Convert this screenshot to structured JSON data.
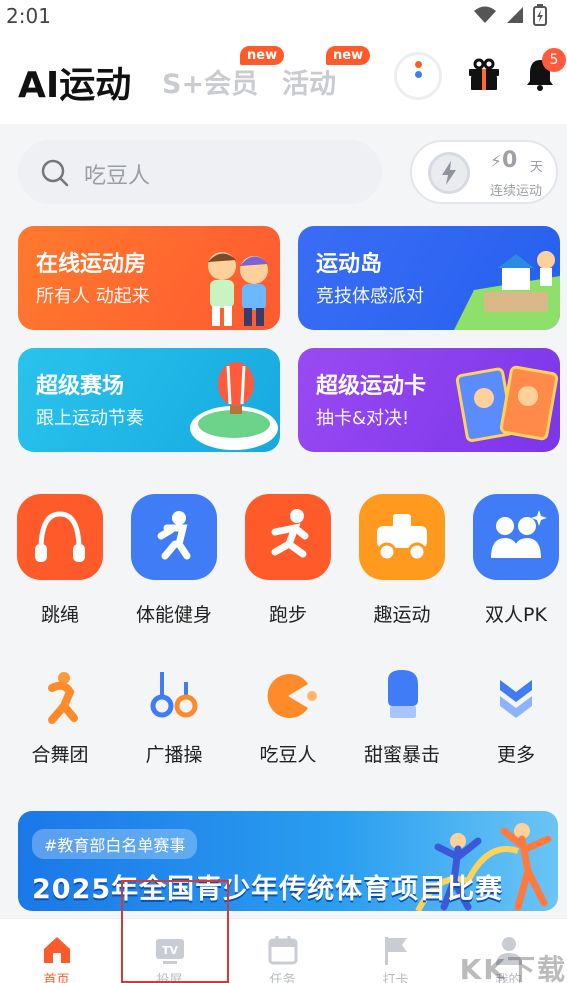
{
  "status": {
    "time": "2:01"
  },
  "header": {
    "title": "AI运动",
    "tabs": [
      {
        "label": "S+会员",
        "badge": "new"
      },
      {
        "label": "活动",
        "badge": "new"
      }
    ],
    "notification_count": "5"
  },
  "search": {
    "placeholder": "吃豆人"
  },
  "streak": {
    "count": "0",
    "unit": "天",
    "label": "连续运动"
  },
  "cards": [
    {
      "title": "在线运动房",
      "subtitle": "所有人 动起来",
      "color": "#ff6a2e"
    },
    {
      "title": "运动岛",
      "subtitle": "竞技体感派对",
      "color": "#2e6cf5"
    },
    {
      "title": "超级赛场",
      "subtitle": "跟上运动节奏",
      "color": "#22b8e6"
    },
    {
      "title": "超级运动卡",
      "subtitle": "抽卡&对决!",
      "color": "#8a3cf0"
    }
  ],
  "grid_row1": [
    {
      "label": "跳绳",
      "icon": "jump-rope-icon",
      "color": "#ff5a2a"
    },
    {
      "label": "体能健身",
      "icon": "fitness-icon",
      "color": "#3f7cf6"
    },
    {
      "label": "跑步",
      "icon": "running-icon",
      "color": "#ff5a2a"
    },
    {
      "label": "趣运动",
      "icon": "fun-sport-icon",
      "color": "#ff9a1f"
    },
    {
      "label": "双人PK",
      "icon": "duo-pk-icon",
      "color": "#3f7cf6"
    }
  ],
  "grid_row2": [
    {
      "label": "合舞团",
      "icon": "dance-icon"
    },
    {
      "label": "广播操",
      "icon": "exercise-icon"
    },
    {
      "label": "吃豆人",
      "icon": "pacman-icon"
    },
    {
      "label": "甜蜜暴击",
      "icon": "boxing-glove-icon"
    },
    {
      "label": "更多",
      "icon": "more-icon"
    }
  ],
  "banner": {
    "tag": "#教育部白名单赛事",
    "title": "2025年全国青少年传统体育项目比赛"
  },
  "nav": [
    {
      "label": "首页",
      "icon": "home-icon",
      "active": true
    },
    {
      "label": "投屏",
      "icon": "tv-icon"
    },
    {
      "label": "任务",
      "icon": "calendar-icon"
    },
    {
      "label": "打卡",
      "icon": "flag-icon"
    },
    {
      "label": "我的",
      "icon": "profile-icon"
    }
  ],
  "watermark": "KK下载"
}
